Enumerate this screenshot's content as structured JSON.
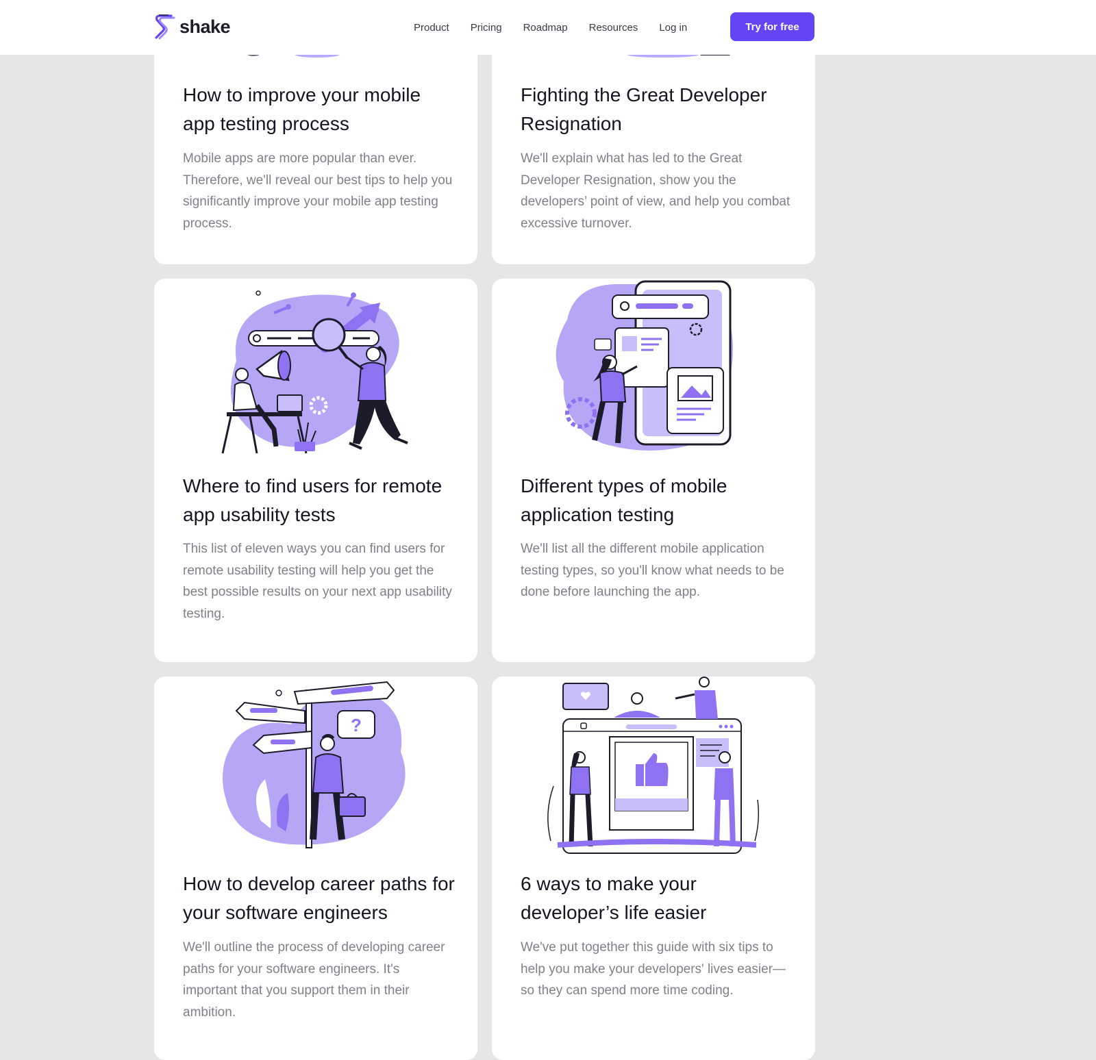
{
  "header": {
    "brand_name": "shake",
    "brand_color": "#6444f4",
    "nav": [
      "Product",
      "Pricing",
      "Roadmap",
      "Resources",
      "Log in"
    ],
    "cta_label": "Try for free"
  },
  "articles": [
    {
      "title": "How to improve your mobile app testing process",
      "excerpt": "Mobile apps are more popular than ever. Therefore, we'll reveal our best tips to help you significantly improve your mobile app testing process."
    },
    {
      "title": "Fighting the Great Developer Resignation",
      "excerpt": "We'll explain what has led to the Great Developer Resignation, show you the developers’ point of view, and help you combat excessive turnover."
    },
    {
      "title": "Where to find users for remote app usability tests",
      "excerpt": "This list of eleven ways you can find users for remote usability testing will help you get the best possible results on your next app usability testing."
    },
    {
      "title": "Different types of mobile application testing",
      "excerpt": "We'll list all the different mobile application testing types, so you'll know what needs to be done before launching the app."
    },
    {
      "title": "How to develop career paths for your software engineers",
      "excerpt": "We'll outline the process of developing career paths for your software engineers. It's important that you support them in their ambition."
    },
    {
      "title": "6 ways to make your developer’s life easier",
      "excerpt": "We've put together this guide with six tips to help you make your developers' lives easier—so they can spend more time coding."
    }
  ]
}
